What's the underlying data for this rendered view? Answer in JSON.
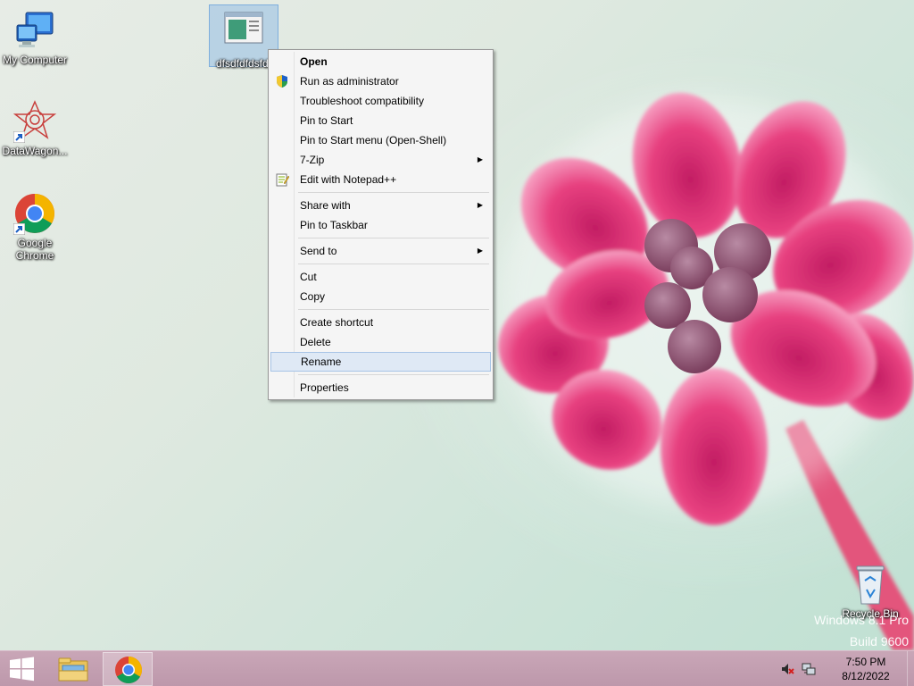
{
  "desktop": {
    "icons": {
      "my_computer": "My Computer",
      "datawagon": "DataWagon...",
      "chrome_line1": "Google",
      "chrome_line2": "Chrome",
      "selected_file": "dfsdfdfdsfdf",
      "recycle_bin": "Recycle Bin"
    },
    "watermark": {
      "line1": "Windows 8.1 Pro",
      "line2": "Build 9600"
    }
  },
  "context_menu": {
    "items": [
      "Open",
      "Run as administrator",
      "Troubleshoot compatibility",
      "Pin to Start",
      "Pin to Start menu (Open-Shell)",
      "7-Zip",
      "Edit with Notepad++",
      "Share with",
      "Pin to Taskbar",
      "Send to",
      "Cut",
      "Copy",
      "Create shortcut",
      "Delete",
      "Rename",
      "Properties"
    ],
    "submenu_arrow": "▶"
  },
  "taskbar": {
    "time": "7:50 PM",
    "date": "8/12/2022"
  },
  "colors": {
    "taskbar": "#c3a0b2",
    "menu_bg": "#f5f5f5",
    "menu_highlight": "#dfe9f5",
    "flower": "#e8447f"
  }
}
